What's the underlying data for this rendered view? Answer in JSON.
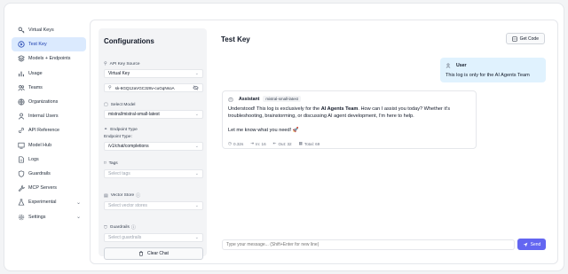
{
  "sidebar": {
    "items": [
      {
        "label": "Virtual Keys",
        "icon": "key-icon"
      },
      {
        "label": "Test Key",
        "icon": "play-icon",
        "active": true
      },
      {
        "label": "Models + Endpoints",
        "icon": "layers-icon"
      },
      {
        "label": "Usage",
        "icon": "bar-chart-icon"
      },
      {
        "label": "Teams",
        "icon": "users-icon"
      },
      {
        "label": "Organizations",
        "icon": "building-icon"
      },
      {
        "label": "Internal Users",
        "icon": "user-icon"
      },
      {
        "label": "API Reference",
        "icon": "api-icon"
      },
      {
        "label": "Model Hub",
        "icon": "grid-icon"
      },
      {
        "label": "Logs",
        "icon": "file-icon"
      },
      {
        "label": "Guardrails",
        "icon": "shield-icon"
      },
      {
        "label": "MCP Servers",
        "icon": "tool-icon"
      },
      {
        "label": "Experimental",
        "icon": "beaker-icon",
        "expandable": true
      },
      {
        "label": "Settings",
        "icon": "gear-icon",
        "expandable": true
      }
    ]
  },
  "config": {
    "title": "Configurations",
    "api_key_source_label": "API Key Source",
    "api_key_source_value": "Virtual Key",
    "api_key_value": "sk-6GQ12aVGC3z8v-cuGqNsoA",
    "select_model_label": "Select Model",
    "select_model_value": "mistral/mistral-small-latest",
    "endpoint_type_label": "Endpoint Type",
    "endpoint_type_sub_label": "Endpoint Type:",
    "endpoint_type_value": "/v1/chat/completions",
    "tags_label": "Tags",
    "tags_placeholder": "Select tags",
    "vector_store_label": "Vector Store",
    "vector_store_placeholder": "Select vector stores",
    "guardrails_label": "Guardrails",
    "guardrails_placeholder": "Select guardrails",
    "clear_chat_label": "Clear Chat"
  },
  "chat": {
    "title": "Test Key",
    "get_code_label": "Get Code",
    "user_role": "User",
    "user_message": "This log is only for the AI Agents Team",
    "assistant_role": "Assistant",
    "assistant_model": "mistral-small-latest",
    "assistant_p1_pre": "Understood! This log is exclusively for the ",
    "assistant_p1_bold": "AI Agents Team",
    "assistant_p1_post": ". How can I assist you today? Whether it's troubleshooting, brainstorming, or discussing AI agent development, I'm here to help.",
    "assistant_p2": "Let me know what you need! 🚀",
    "metrics": {
      "time": "0.32s",
      "in": "In: 16",
      "out": "Out: 32",
      "total": "Total: 69"
    },
    "composer_placeholder": "Type your message... (Shift+Enter for new line)",
    "send_label": "Send"
  }
}
